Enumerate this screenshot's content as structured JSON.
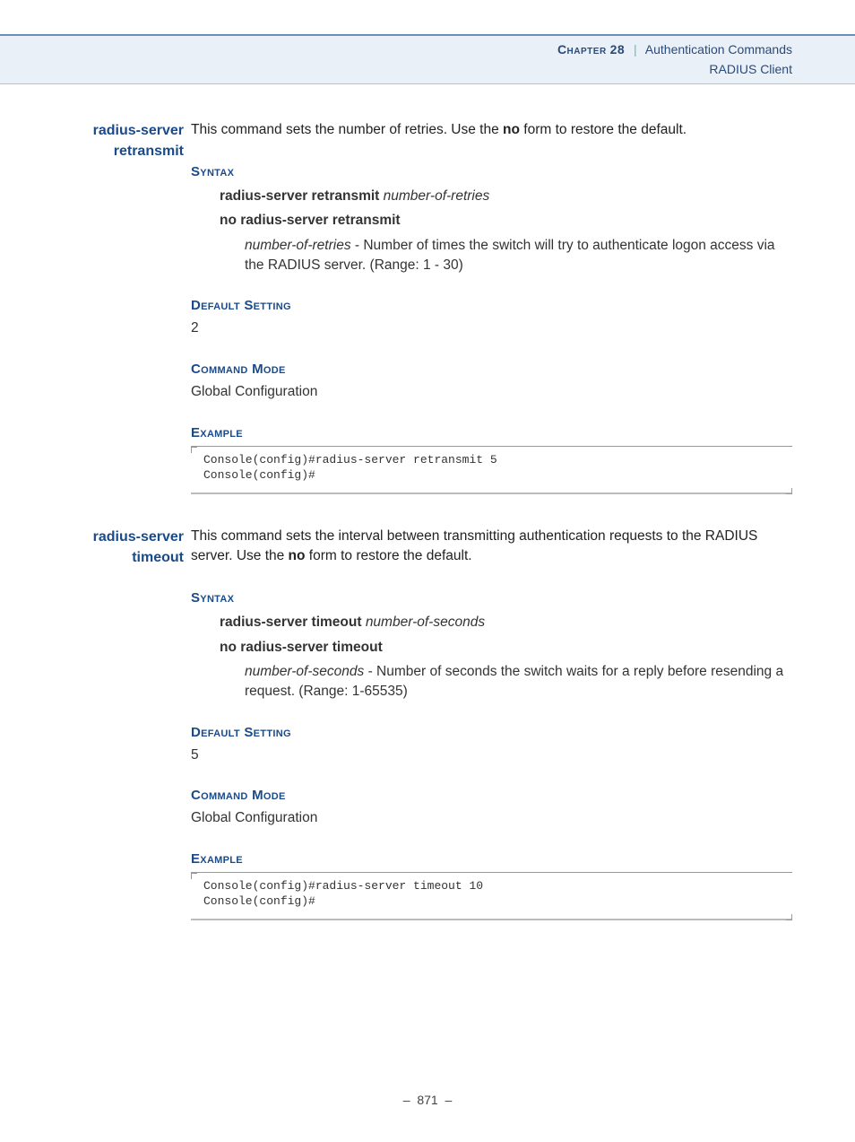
{
  "header": {
    "chapter_word": "Chapter",
    "chapter_num": "28",
    "chapter_title": "Authentication Commands",
    "subtitle": "RADIUS Client"
  },
  "entries": [
    {
      "label": "radius-server retransmit",
      "desc_pre": "This command sets the number of retries. Use the ",
      "desc_bold": "no",
      "desc_post": " form to restore the default.",
      "syntax_heading": "Syntax",
      "syntax_cmd_kw": "radius-server retransmit",
      "syntax_cmd_arg": "number-of-retries",
      "syntax_no": "no radius-server retransmit",
      "param_arg": "number-of-retries",
      "param_text": " - Number of times the switch will try to authenticate logon access via the RADIUS server. (Range: 1 - 30)",
      "default_heading": "Default Setting",
      "default_value": "2",
      "mode_heading": "Command Mode",
      "mode_value": "Global Configuration",
      "example_heading": "Example",
      "example_code": "Console(config)#radius-server retransmit 5\nConsole(config)#"
    },
    {
      "label": "radius-server timeout",
      "desc_pre": "This command sets the interval between transmitting authentication requests to the RADIUS server. Use the ",
      "desc_bold": "no",
      "desc_post": " form to restore the default.",
      "syntax_heading": "Syntax",
      "syntax_cmd_kw": "radius-server timeout",
      "syntax_cmd_arg": "number-of-seconds",
      "syntax_no": "no radius-server timeout",
      "param_arg": "number-of-seconds",
      "param_text": " - Number of seconds the switch waits for a reply before resending a request. (Range: 1-65535)",
      "default_heading": "Default Setting",
      "default_value": "5",
      "mode_heading": "Command Mode",
      "mode_value": "Global Configuration",
      "example_heading": "Example",
      "example_code": "Console(config)#radius-server timeout 10\nConsole(config)#"
    }
  ],
  "footer": {
    "page_dash_left": "–",
    "page_number": "871",
    "page_dash_right": "–"
  }
}
